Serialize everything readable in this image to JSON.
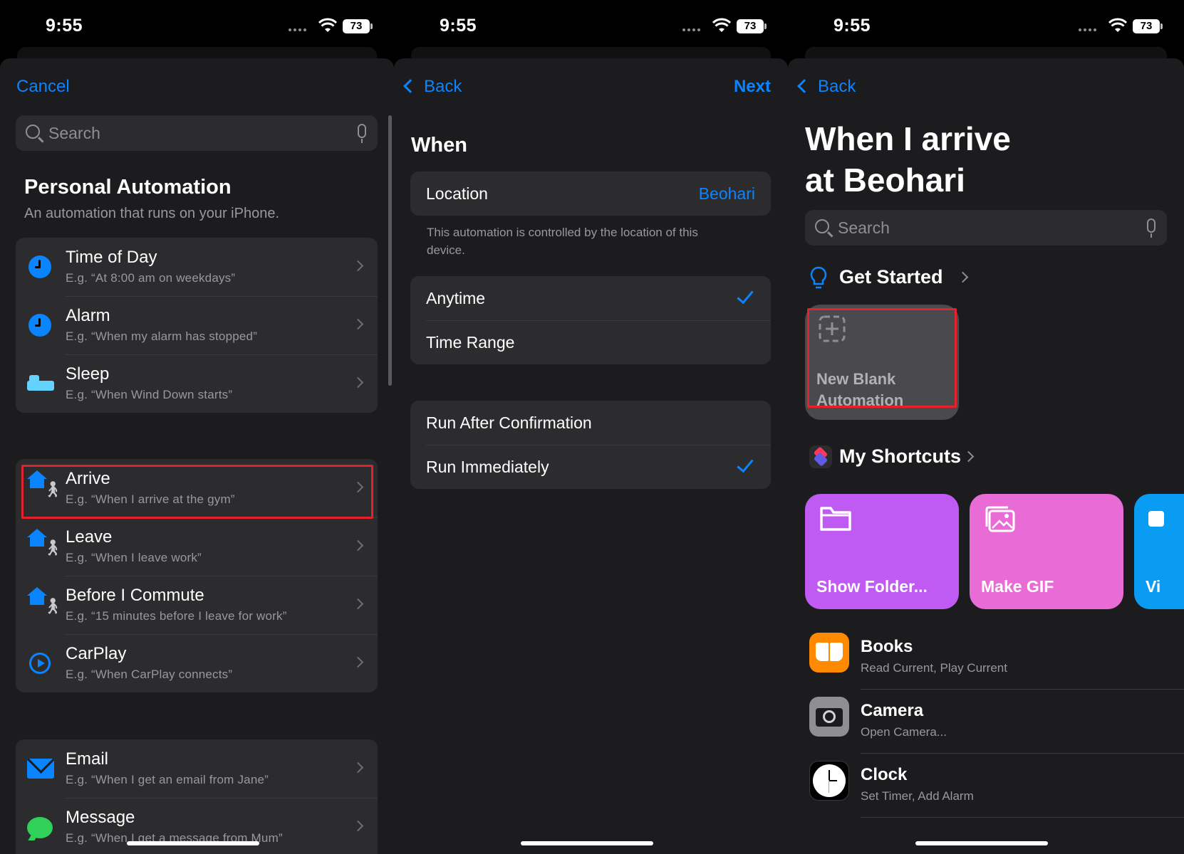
{
  "status": {
    "time": "9:55",
    "battery": "73"
  },
  "screen1": {
    "cancel": "Cancel",
    "search_placeholder": "Search",
    "heading": "Personal Automation",
    "subheading": "An automation that runs on your iPhone.",
    "group1": [
      {
        "title": "Time of Day",
        "sub": "E.g. “At 8:00 am on weekdays”",
        "icon": "clock-icon"
      },
      {
        "title": "Alarm",
        "sub": "E.g. “When my alarm has stopped”",
        "icon": "alarm-clock-icon"
      },
      {
        "title": "Sleep",
        "sub": "E.g. “When Wind Down starts”",
        "icon": "bed-icon"
      }
    ],
    "group2": [
      {
        "title": "Arrive",
        "sub": "E.g. “When I arrive at the gym”",
        "icon": "house-walker-icon"
      },
      {
        "title": "Leave",
        "sub": "E.g. “When I leave work”",
        "icon": "house-walker-icon"
      },
      {
        "title": "Before I Commute",
        "sub": "E.g. “15 minutes before I leave for work”",
        "icon": "house-walker-icon"
      },
      {
        "title": "CarPlay",
        "sub": "E.g. “When CarPlay connects”",
        "icon": "carplay-icon"
      }
    ],
    "group3": [
      {
        "title": "Email",
        "sub": "E.g. “When I get an email from Jane”",
        "icon": "mail-icon"
      },
      {
        "title": "Message",
        "sub": "E.g. “When I get a message from Mum”",
        "icon": "message-icon"
      }
    ]
  },
  "screen2": {
    "back": "Back",
    "next": "Next",
    "section_title": "When",
    "location_label": "Location",
    "location_value": "Beohari",
    "location_footer": "This automation is controlled by the location of this device.",
    "time_options": [
      "Anytime",
      "Time Range"
    ],
    "run_options": [
      "Run After Confirmation",
      "Run Immediately"
    ]
  },
  "screen3": {
    "back": "Back",
    "title_line1": "When I arrive",
    "title_line2": "at Beohari",
    "search_placeholder": "Search",
    "get_started": "Get Started",
    "new_blank_line1": "New Blank",
    "new_blank_line2": "Automation",
    "my_shortcuts": "My Shortcuts",
    "shortcuts": [
      {
        "label": "Show Folder...",
        "color": "#bf5af2"
      },
      {
        "label": "Make GIF",
        "color": "#e86bd6"
      },
      {
        "label": "Vi",
        "color": "#0a9bf2"
      }
    ],
    "apps": [
      {
        "name": "Books",
        "sub": "Read Current, Play Current",
        "color": "#ff8a00"
      },
      {
        "name": "Camera",
        "sub": "Open Camera...",
        "color": "#8e8e93"
      },
      {
        "name": "Clock",
        "sub": "Set Timer, Add Alarm",
        "color": "#ffffff"
      }
    ]
  },
  "colors": {
    "accent": "#0a84ff",
    "highlight": "#e5212b"
  }
}
